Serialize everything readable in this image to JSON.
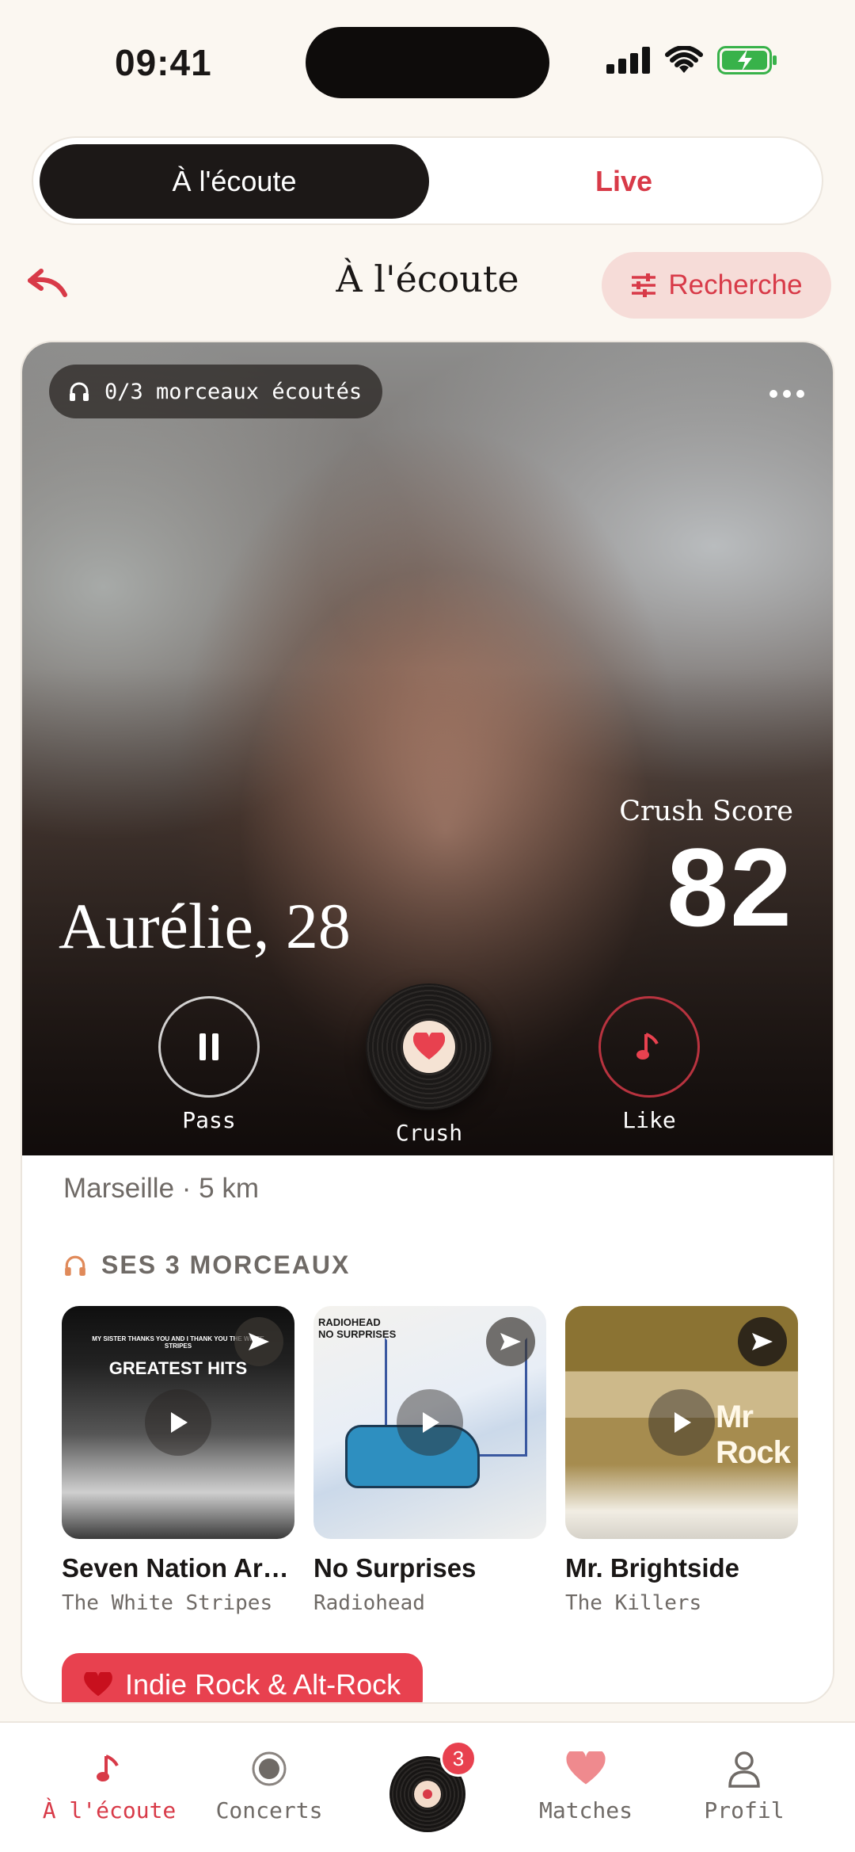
{
  "status_bar": {
    "time": "09:41"
  },
  "segmented": {
    "active_label": "À l'écoute",
    "other_label": "Live"
  },
  "header": {
    "title": "À l'écoute",
    "search_label": "Recherche"
  },
  "profile": {
    "listened_text": "0/3 morceaux écoutés",
    "name_age": "Aurélie, 28",
    "crush_score_label": "Crush Score",
    "crush_score": "82",
    "location": "Marseille · 5 km"
  },
  "actions": {
    "pass": "Pass",
    "crush": "Crush",
    "like": "Like"
  },
  "tracks_section": {
    "title": "SES 3 MORCEAUX",
    "tracks": [
      {
        "title": "Seven Nation Army",
        "artist": "The White Stripes",
        "cover_line1": "MY SISTER THANKS YOU AND I THANK YOU THE WHITE STRIPES",
        "cover_line2": "GREATEST HITS"
      },
      {
        "title": "No Surprises",
        "artist": "Radiohead",
        "cover_text": "RADIOHEAD NO SURPRISES"
      },
      {
        "title": "Mr. Brightside",
        "artist": "The Killers",
        "cover_text": "Mr Rock"
      }
    ]
  },
  "genre_chip": "Indie Rock & Alt-Rock",
  "tab_bar": {
    "tabs": [
      "À l'écoute",
      "Concerts",
      "Matches",
      "Profil"
    ],
    "badge_count": "3"
  },
  "colors": {
    "accent": "#d83a48",
    "background": "#fbf7f1",
    "dark": "#1c1817"
  }
}
